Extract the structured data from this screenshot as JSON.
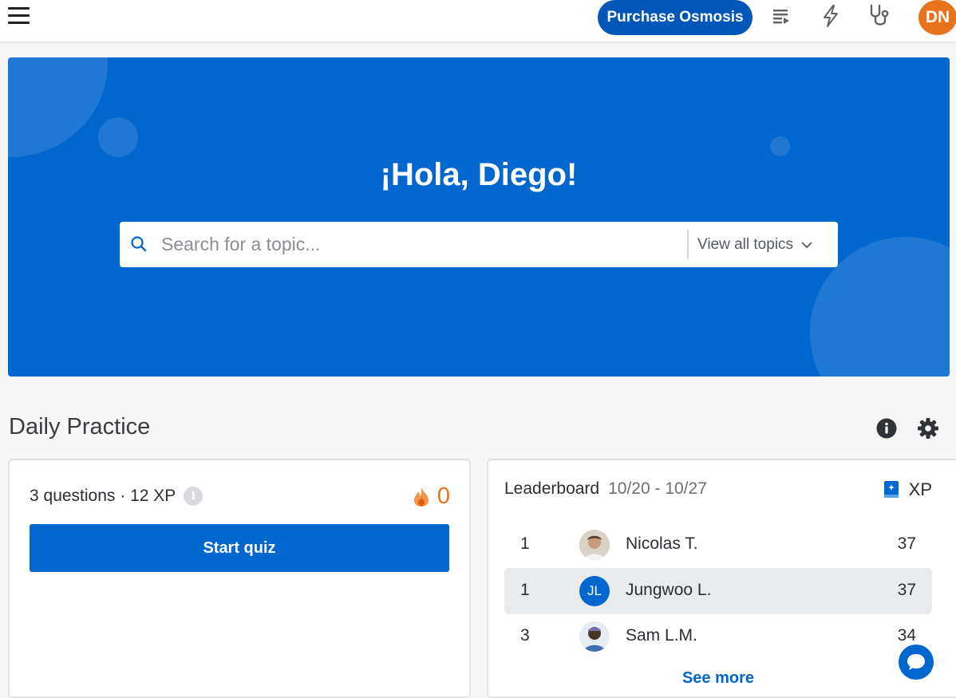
{
  "header": {
    "purchase_label": "Purchase Osmosis",
    "avatar_initials": "DN",
    "icons": [
      "hamburger-menu-icon",
      "playlist-icon",
      "lightning-icon",
      "stethoscope-icon"
    ]
  },
  "hero": {
    "greeting": "¡Hola, Diego!",
    "search_placeholder": "Search for a topic...",
    "view_all_label": "View all topics"
  },
  "daily_practice": {
    "title": "Daily Practice",
    "quiz": {
      "meta": "3 questions · 12 XP",
      "info_glyph": "i",
      "streak": "0",
      "start_label": "Start quiz"
    },
    "leaderboard": {
      "title": "Leaderboard",
      "range": "10/20 - 10/27",
      "xp_label": "XP",
      "rows": [
        {
          "rank": "1",
          "name": "Nicolas T.",
          "score": "37",
          "avatar": "photo"
        },
        {
          "rank": "1",
          "name": "Jungwoo L.",
          "score": "37",
          "avatar": "initials",
          "initials": "JL",
          "me": true
        },
        {
          "rank": "3",
          "name": "Sam L.M.",
          "score": "34",
          "avatar": "photo"
        }
      ],
      "see_more_label": "See more"
    }
  },
  "colors": {
    "brand_blue": "#0067cf",
    "dark_blue": "#0057b8",
    "orange": "#e8731a"
  }
}
